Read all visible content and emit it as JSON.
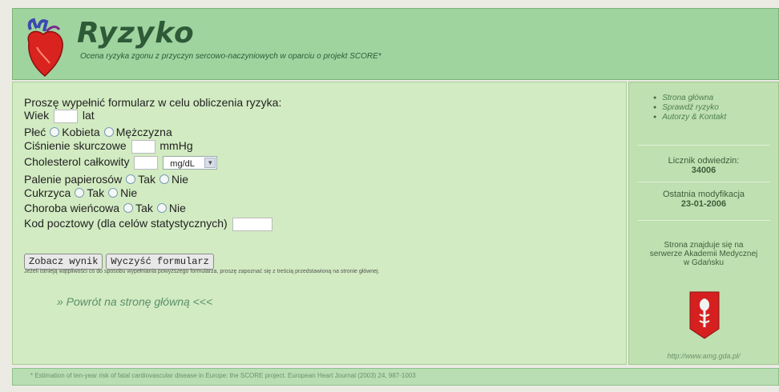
{
  "header": {
    "title": "Ryzyko",
    "subtitle": "Ocena ryzyka zgonu z przyczyn sercowo-naczyniowych w oparciu o projekt SCORE*"
  },
  "form": {
    "intro": "Proszę wypełnić formularz w celu obliczenia ryzyka:",
    "age_label": "Wiek",
    "age_unit": "lat",
    "age_value": "",
    "sex_label": "Płeć",
    "sex_female": "Kobieta",
    "sex_male": "Mężczyzna",
    "bp_label": "Ciśnienie skurczowe",
    "bp_unit": "mmHg",
    "bp_value": "",
    "chol_label": "Cholesterol całkowity",
    "chol_value": "",
    "chol_unit_selected": "mg/dL",
    "smoking_label": "Palenie papierosów",
    "yes": "Tak",
    "no": "Nie",
    "diabetes_label": "Cukrzyca",
    "chd_label": "Choroba wieńcowa",
    "postal_label": "Kod pocztowy (dla celów statystycznych)",
    "postal_value": "",
    "submit_button": "Zobacz wynik",
    "clear_button": "Wyczyść formularz",
    "help_note": "Jeżeli istnieją wątpliwości co do sposobu wypełniania powyższego formularza, proszę zapoznać się z treścią przedstawioną na stronie głównej.",
    "back_link": "» Powrót na stronę główną <<<"
  },
  "sidebar": {
    "links": [
      "Strona główna",
      "Sprawdź ryzyko",
      "Autorzy & Kontakt"
    ],
    "counter_label": "Licznik odwiedzin:",
    "counter_value": "34006",
    "modified_label": "Ostatnia modyfikacja",
    "modified_value": "23-01-2006",
    "host_note_1": "Strona znajduje się na",
    "host_note_2": "serwerze Akademii Medycznej",
    "host_note_3": "w Gdańsku",
    "host_url": "http://www.amg.gda.pl/"
  },
  "footer": {
    "citation": "* Estimation of ten-year risk of fatal cardiovascular disease in Europe: the SCORE project. European Heart Journal (2003) 24, 987-1003"
  },
  "icons": {
    "logo": "heart-icon",
    "crest": "amg-crest-icon",
    "dropdown": "chevron-down-icon"
  },
  "colors": {
    "header_bg": "#9fd49f",
    "title": "#2f5a38",
    "main_bg": "#d2ebc2",
    "sidebar_bg": "#bfe0b1",
    "crest_red": "#d62020"
  }
}
